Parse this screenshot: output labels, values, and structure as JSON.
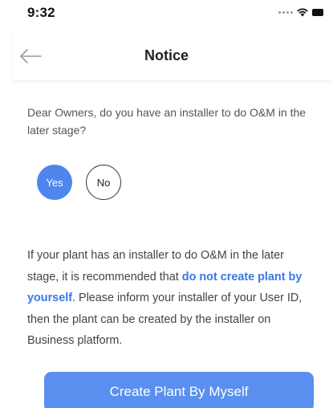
{
  "status_bar": {
    "time": "9:32",
    "icons": [
      "signal-dots-icon",
      "wifi-icon",
      "battery-icon"
    ]
  },
  "nav": {
    "back_icon": "arrow-left-icon",
    "title": "Notice"
  },
  "question": {
    "text": "Dear Owners, do you have an installer to do O&M in the later stage?"
  },
  "choices": {
    "yes_label": "Yes",
    "no_label": "No",
    "selected": "Yes"
  },
  "info": {
    "part1": "If your plant has an installer to do O&M in the later stage, it is recommended that ",
    "highlight": "do not create plant by yourself",
    "part2": ". Please inform your installer of your User ID, then the plant can be created by the installer on Business platform."
  },
  "actions": {
    "create_label": "Create Plant By Myself"
  },
  "colors": {
    "accent": "#4f86ee",
    "highlight_text": "#3a78e8",
    "button": "#5a8fef"
  }
}
